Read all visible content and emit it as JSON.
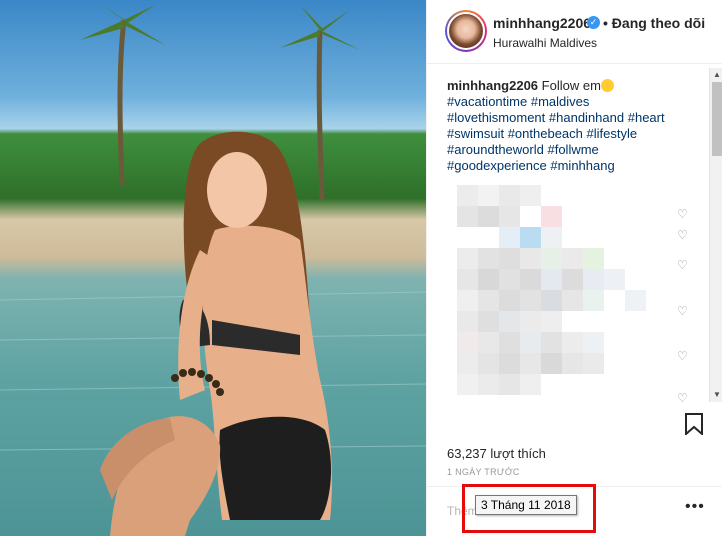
{
  "post": {
    "username": "minhhang2206",
    "follow_label": "• Đang theo dõi",
    "location": "Hurawalhi Maldives"
  },
  "caption": {
    "username": "minhhang2206",
    "text": "Follow em",
    "emoji_icon": "tongue-out-emoji-icon",
    "hashtags": [
      "#vacationtime",
      "#maldives",
      "#lovethismoment",
      "#handinhand",
      "#heart",
      "#swimsuit",
      "#onthebeach",
      "#lifestyle",
      "#aroundtheworld",
      "#follwme",
      "#goodexperience",
      "#minhhang"
    ]
  },
  "stats": {
    "likes": "63,237 lượt thích",
    "time_ago": "1 NGÀY TRƯỚC"
  },
  "comment_box": {
    "placeholder": "Thêm"
  },
  "tooltip": {
    "date": "3 Tháng 11 2018"
  },
  "icons": {
    "verified": "verified-badge-icon",
    "bookmark": "bookmark-icon",
    "more": "more-options-icon",
    "heart": "heart-icon"
  },
  "colors": {
    "hashtag": "#003569",
    "verified": "#3897f0",
    "highlight_box": "#e30b0b"
  }
}
